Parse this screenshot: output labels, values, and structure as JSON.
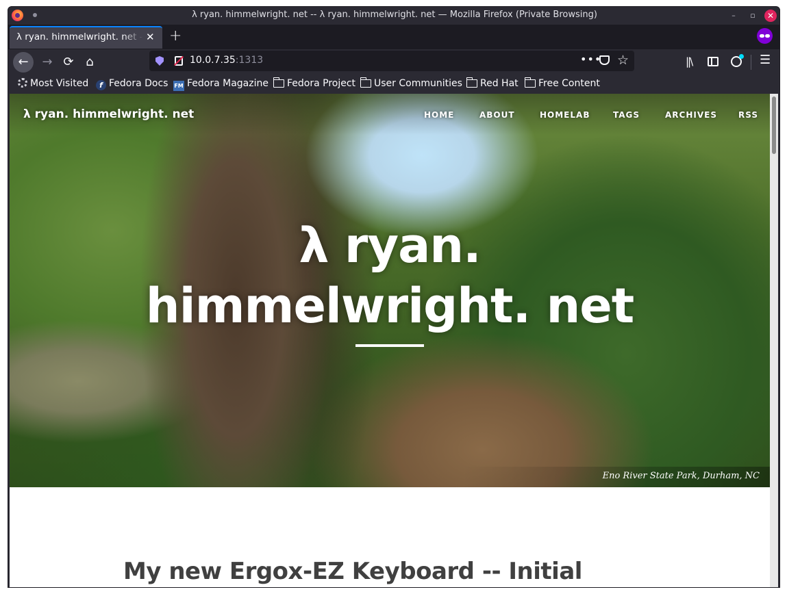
{
  "window": {
    "title": "λ ryan. himmelwright. net -- λ ryan. himmelwright. net — Mozilla Firefox (Private Browsing)",
    "minimize": "–",
    "maximize": "▫",
    "close": "✕"
  },
  "tabs": [
    {
      "label": "λ ryan. himmelwright. net -- λ ryan. himmelwright. net",
      "close": "✕"
    }
  ],
  "tabstrip": {
    "new_tab": "+"
  },
  "navbar": {
    "back": "←",
    "forward": "→",
    "reload": "⟳",
    "home": "⌂",
    "url_host": "10.0.7.35",
    "url_port": ":1313",
    "page_actions": "•••",
    "bookmark_star": "☆",
    "library": "||\\",
    "menu": "☰"
  },
  "bookmarks": [
    {
      "label": "Most Visited",
      "icon": "gear-icon"
    },
    {
      "label": "Fedora Docs",
      "icon": "fedora-icon",
      "glyph": "f"
    },
    {
      "label": "Fedora Magazine",
      "icon": "fm-icon",
      "glyph": "FM"
    },
    {
      "label": "Fedora Project",
      "icon": "folder-icon"
    },
    {
      "label": "User Communities",
      "icon": "folder-icon"
    },
    {
      "label": "Red Hat",
      "icon": "folder-icon"
    },
    {
      "label": "Free Content",
      "icon": "folder-icon"
    }
  ],
  "site": {
    "brand": "λ ryan. himmelwright. net",
    "nav": [
      "HOME",
      "ABOUT",
      "HOMELAB",
      "TAGS",
      "ARCHIVES",
      "RSS"
    ],
    "hero_title_line1": "λ ryan.",
    "hero_title_line2": "himmelwright. net",
    "photo_caption": "Eno River State Park, Durham, NC",
    "post_title": "My new Ergox-EZ Keyboard -- Initial"
  },
  "colors": {
    "chrome_bg": "#2b2a33",
    "tabstrip_bg": "#1c1b22",
    "active_tab": "#42414d",
    "accent": "#0a84ff",
    "private_purple": "#8000d7",
    "close_red": "#e0245e",
    "post_title": "#404040"
  }
}
